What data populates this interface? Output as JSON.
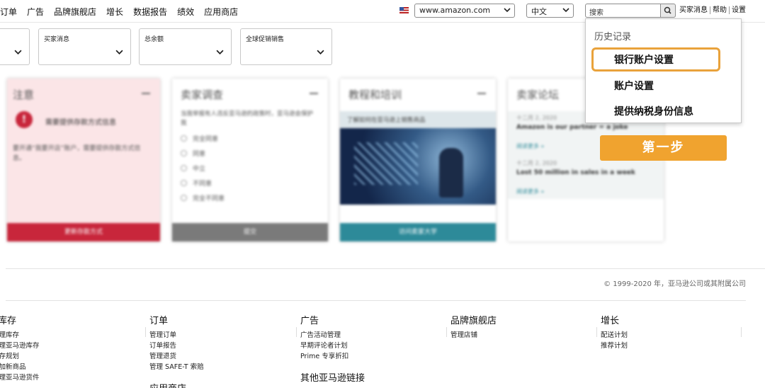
{
  "nav": {
    "items": [
      "订单",
      "广告",
      "品牌旗舰店",
      "增长",
      "数据报告",
      "绩效",
      "应用商店"
    ],
    "marketplace": "www.amazon.com",
    "language": "中文",
    "search_placeholder": "搜索",
    "links": [
      "买家消息",
      "帮助",
      "设置"
    ]
  },
  "filters": [
    {
      "label": ""
    },
    {
      "label": "买家消息"
    },
    {
      "label": "总余额"
    },
    {
      "label": "全球促销销售"
    }
  ],
  "widgets": [
    {
      "title": "注意",
      "button": "更新存款方式",
      "color": "#c8263b"
    },
    {
      "title": "卖家调查",
      "button": "提交",
      "color": "#7a7a7a"
    },
    {
      "title": "教程和培训",
      "button": "访问卖家大学",
      "color": "#2d8a99"
    },
    {
      "title": "卖家论坛",
      "button": "",
      "color": ""
    }
  ],
  "widget_texts": {
    "notice_heading": "需要提供存款方式信息",
    "notice_body": "要开通“我要开店”账户，需要提供存款方式信息。",
    "survey_question": "当我举报有人违反亚马逊的政策时，亚马逊会保护我",
    "survey_options": [
      "完全同意",
      "同意",
      "中立",
      "不同意",
      "完全不同意"
    ],
    "tutorial_caption": "了解如何在亚马逊上销售商品",
    "forum_date1": "十二月 2, 2020",
    "forum_headline1": "Amazon is our partner = a joke",
    "forum_more": "阅读更多 »",
    "forum_date2": "十二月 2, 2020",
    "forum_headline2": "Lost 50 million in sales in a week"
  },
  "dropdown": {
    "heading": "历史记录",
    "items": [
      "银行账户设置",
      "账户设置",
      "提供纳税身份信息"
    ]
  },
  "step_label": "第一步",
  "footer": {
    "copyright": "© 1999-2020 年，亚马逊公司或其附属公司",
    "columns": [
      {
        "heading": "库存",
        "links": [
          "管理库存",
          "管理亚马逊库存",
          "库存规划",
          "添加新商品",
          "管理亚马逊货件"
        ]
      },
      {
        "heading": "订单",
        "links": [
          "管理订单",
          "订单报告",
          "管理退货",
          "管理 SAFE-T 索赔"
        ]
      },
      {
        "heading": "广告",
        "links": [
          "广告活动管理",
          "早期评论者计划",
          "Prime 专享折扣"
        ]
      },
      {
        "heading": "品牌旗舰店",
        "links": [
          "管理店铺"
        ]
      },
      {
        "heading": "增长",
        "links": [
          "配送计划",
          "推荐计划"
        ]
      }
    ],
    "other_links_heading": "其他亚马逊链接",
    "partial_heading": "应用商店"
  },
  "colors": {
    "accent_orange": "#f0a32f",
    "highlight_border": "#e9a23b"
  }
}
